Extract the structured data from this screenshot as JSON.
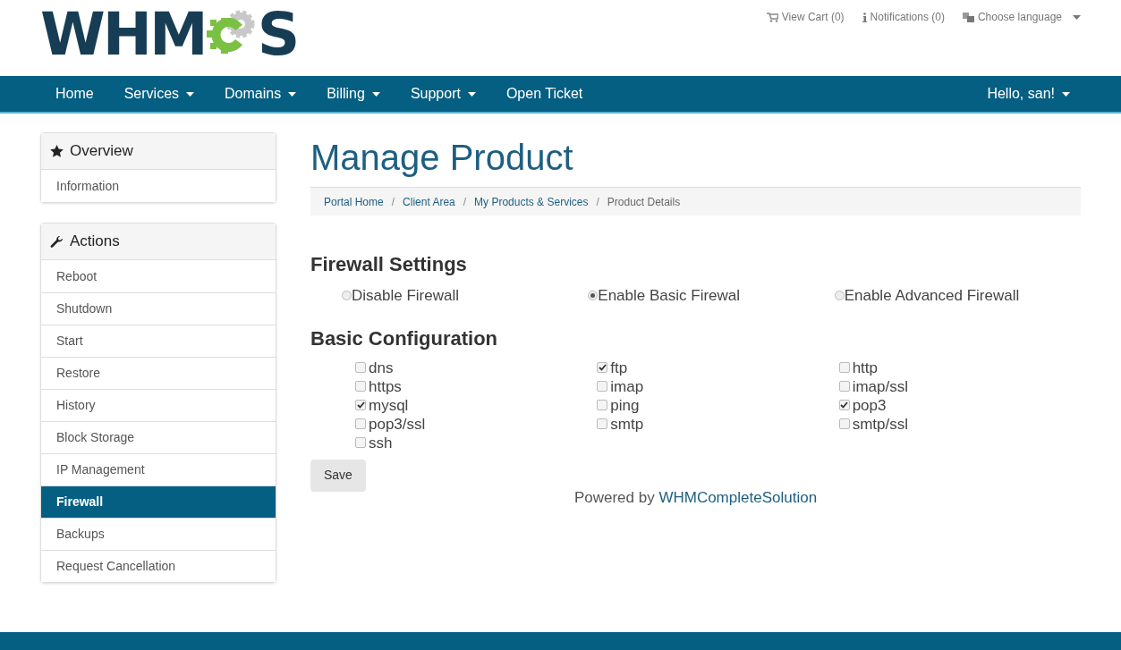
{
  "logo": {
    "text_before": "WHM",
    "text_after": "S"
  },
  "top_links": [
    {
      "kind": "cart",
      "label": "View Cart (0)"
    },
    {
      "kind": "info",
      "label": "Notifications (0)"
    },
    {
      "kind": "language",
      "label": "Choose language",
      "dropdown": true
    }
  ],
  "nav": [
    {
      "label": "Home",
      "dropdown": false
    },
    {
      "label": "Services",
      "dropdown": true
    },
    {
      "label": "Domains",
      "dropdown": true
    },
    {
      "label": "Billing",
      "dropdown": true
    },
    {
      "label": "Support",
      "dropdown": true
    },
    {
      "label": "Open Ticket",
      "dropdown": false
    }
  ],
  "user_menu": {
    "label": "Hello, san!",
    "dropdown": true
  },
  "sidebar": [
    {
      "title": "Overview",
      "items": [
        {
          "label": "Information",
          "selected": false
        }
      ]
    },
    {
      "title": "Actions",
      "items": [
        {
          "label": "Reboot",
          "selected": false
        },
        {
          "label": "Shutdown",
          "selected": false
        },
        {
          "label": "Start",
          "selected": false
        },
        {
          "label": "Restore",
          "selected": false
        },
        {
          "label": "History",
          "selected": false
        },
        {
          "label": "Block Storage",
          "selected": false
        },
        {
          "label": "IP Management",
          "selected": false
        },
        {
          "label": "Firewall",
          "selected": true
        },
        {
          "label": "Backups",
          "selected": false
        },
        {
          "label": "Request Cancellation",
          "selected": false
        }
      ]
    }
  ],
  "page_title": "Manage Product",
  "breadcrumb": {
    "separator": "/",
    "items": [
      "Portal Home",
      "Client Area",
      "My Products & Services",
      "Product Details"
    ]
  },
  "firewall_settings": {
    "heading": "Firewall Settings",
    "options": [
      {
        "label": "Disable Firewall",
        "selected": false
      },
      {
        "label": "Enable Basic Firewal",
        "selected": true
      },
      {
        "label": "Enable Advanced Firewall",
        "selected": false
      }
    ]
  },
  "basic_configuration": {
    "heading": "Basic Configuration",
    "services": [
      {
        "label": "dns",
        "checked": false
      },
      {
        "label": "ftp",
        "checked": true
      },
      {
        "label": "http",
        "checked": false
      },
      {
        "label": "https",
        "checked": false
      },
      {
        "label": "imap",
        "checked": false
      },
      {
        "label": "imap/ssl",
        "checked": false
      },
      {
        "label": "mysql",
        "checked": true
      },
      {
        "label": "ping",
        "checked": false
      },
      {
        "label": "pop3",
        "checked": true
      },
      {
        "label": "pop3/ssl",
        "checked": false
      },
      {
        "label": "smtp",
        "checked": false
      },
      {
        "label": "smtp/ssl",
        "checked": false
      },
      {
        "label": "ssh",
        "checked": false
      }
    ]
  },
  "save_button": "Save",
  "powered_by": {
    "text": "Powered by",
    "link": "WHMCompleteSolution"
  }
}
